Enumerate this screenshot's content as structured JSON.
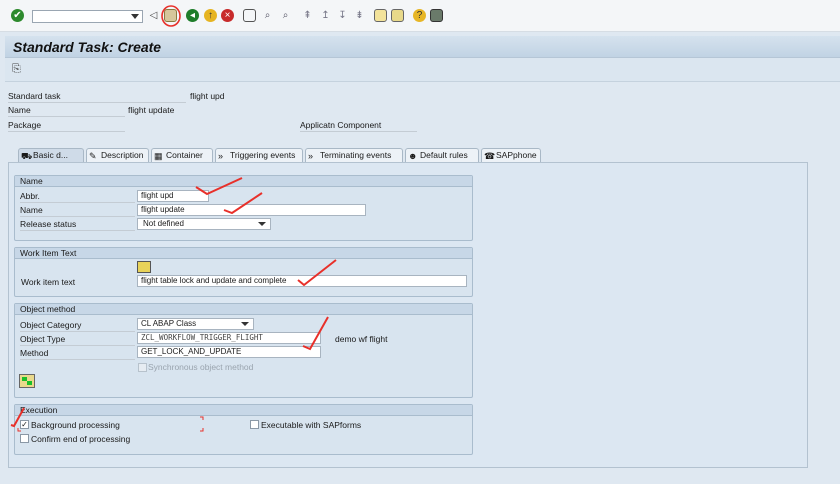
{
  "toolbar": {
    "icons": [
      "enter-icon",
      "save-icon",
      "back-icon",
      "exit-icon",
      "cancel-icon",
      "print-icon",
      "find-icon",
      "find-next-icon",
      "first-page-icon",
      "prev-page-icon",
      "next-page-icon",
      "last-page-icon",
      "create-session-icon",
      "shortcut-icon",
      "help-icon",
      "layout-icon"
    ]
  },
  "title": "Standard Task: Create",
  "header": {
    "standard_task_label": "Standard task",
    "standard_task_value": "flight upd",
    "name_label": "Name",
    "name_value": "flight update",
    "package_label": "Package",
    "app_component_label": "Applicatn Component"
  },
  "tabs": [
    {
      "label": "Basic d...",
      "icon": "basic-data-icon",
      "active": true
    },
    {
      "label": "Description",
      "icon": "description-icon"
    },
    {
      "label": "Container",
      "icon": "container-icon"
    },
    {
      "label": "Triggering events",
      "icon": "events-icon"
    },
    {
      "label": "Terminating events",
      "icon": "events-icon"
    },
    {
      "label": "Default rules",
      "icon": "rules-icon"
    },
    {
      "label": "SAPphone",
      "icon": "phone-icon"
    }
  ],
  "name_group": {
    "title": "Name",
    "abbr_label": "Abbr.",
    "abbr_value": "flight upd",
    "name_label": "Name",
    "name_value": "flight update",
    "release_label": "Release status",
    "release_value": "Not defined"
  },
  "work_item": {
    "title": "Work Item Text",
    "label": "Work item text",
    "value": "flight table lock and update and complete"
  },
  "object_method": {
    "title": "Object method",
    "category_label": "Object Category",
    "category_value": "CL ABAP Class",
    "type_label": "Object Type",
    "type_value": "ZCL_WORKFLOW_TRIGGER_FLIGHT",
    "type_desc": "demo wf flight",
    "method_label": "Method",
    "method_value": "GET_LOCK_AND_UPDATE",
    "sync_label": "Synchronous object method",
    "sync_checked": false
  },
  "execution": {
    "title": "Execution",
    "background_label": "Background processing",
    "background_checked": true,
    "confirm_label": "Confirm end of processing",
    "confirm_checked": false,
    "sapforms_label": "Executable with SAPforms",
    "sapforms_checked": false
  },
  "colors": {
    "annotation": "#e8302a",
    "title_bar": "#c9d9e8",
    "background": "#dfe8f1"
  }
}
